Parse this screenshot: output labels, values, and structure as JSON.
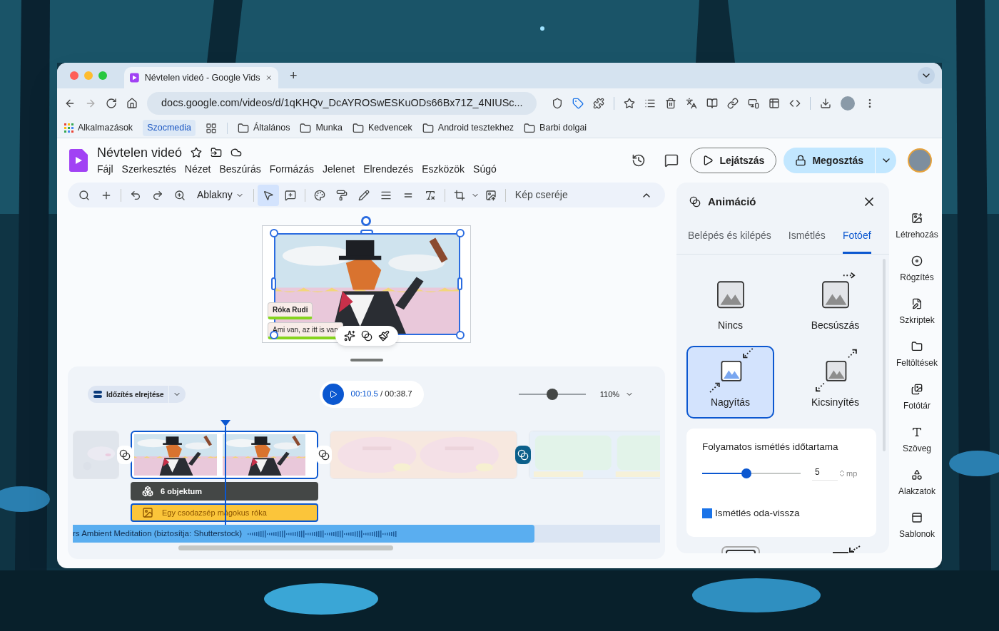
{
  "browser": {
    "tab_title": "Névtelen videó - Google Vids",
    "new_tab": "+",
    "url": "docs.google.com/videos/d/1qKHQv_DcAYROSwESKuODs66Bx71Z_4NIUSc...",
    "bookmarks": [
      {
        "kind": "apps",
        "label": "Alkalmazások"
      },
      {
        "kind": "chip",
        "label": "Szocmedia"
      },
      {
        "kind": "folder",
        "label": "Általános"
      },
      {
        "kind": "folder",
        "label": "Munka"
      },
      {
        "kind": "folder",
        "label": "Kedvencek"
      },
      {
        "kind": "folder",
        "label": "Android tesztekhez"
      },
      {
        "kind": "folder",
        "label": "Barbi dolgai"
      }
    ]
  },
  "app": {
    "title": "Névtelen videó",
    "menus": [
      "Fájl",
      "Szerkesztés",
      "Nézet",
      "Beszúrás",
      "Formázás",
      "Jelenet",
      "Elrendezés",
      "Eszközök",
      "Súgó"
    ],
    "play_button": "Lejátszás",
    "share_button": "Megosztás"
  },
  "toolbar": {
    "view_mode": "Ablakny",
    "select_tool_selected": true,
    "replace_image": "Kép cseréje"
  },
  "slide": {
    "captions": [
      "Róka Rudi",
      "Ami van, az itt is van"
    ]
  },
  "timeline": {
    "hide_timing": "Időzítés elrejtése",
    "current_time": "00:10.5",
    "total_time": "/ 00:38.7",
    "zoom": {
      "level": 0.5,
      "label": "110%"
    },
    "clips": [
      {
        "selected": false
      },
      {
        "selected": true
      },
      {
        "selected": false
      },
      {
        "selected": false
      }
    ],
    "object_track": "6 objektum",
    "image_track": "Egy csodazsép mágokus róka",
    "audio_track": "rs Ambient Meditation (biztosítja: Shutterstock)"
  },
  "panel": {
    "title": "Animáció",
    "tabs": [
      {
        "label": "Belépés és kilépés",
        "selected": false
      },
      {
        "label": "Ismétlés",
        "selected": false
      },
      {
        "label": "Fotóef",
        "selected": true
      }
    ],
    "effects": [
      {
        "kind": "none",
        "label": "Nincs",
        "selected": false
      },
      {
        "kind": "slide",
        "label": "Becsúszás",
        "selected": false
      },
      {
        "kind": "zoom_in",
        "label": "Nagyítás",
        "selected": true
      },
      {
        "kind": "zoom_out",
        "label": "Kicsinyítés",
        "selected": false
      }
    ],
    "settings": {
      "duration_label": "Folyamatos ismétlés időtartama",
      "duration": {
        "level": 0.45
      },
      "value": "5",
      "unit": "mp",
      "loop_label": "Ismétlés oda-vissza",
      "loop_checked": true
    }
  },
  "sidebar": [
    {
      "label": "Létrehozás"
    },
    {
      "label": "Rögzítés"
    },
    {
      "label": "Szkriptek"
    },
    {
      "label": "Feltöltések"
    },
    {
      "label": "Fotótár"
    },
    {
      "label": "Szöveg"
    },
    {
      "label": "Alakzatok"
    },
    {
      "label": "Sablonok"
    }
  ]
}
